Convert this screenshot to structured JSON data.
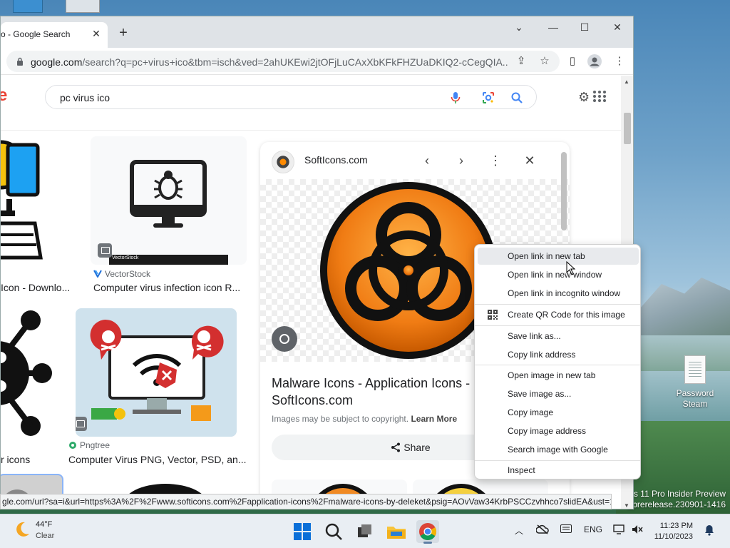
{
  "desktop": {
    "icon_label_line1": "Password",
    "icon_label_line2": "Steam",
    "watermark_line1": "ws 11 Pro Insider Preview",
    "watermark_line2": "s_prerelease.230901-1416"
  },
  "browser": {
    "tab_title": "o - Google Search",
    "new_tab": "+",
    "url_host": "google.com",
    "url_path": "/search?q=pc+virus+ico&tbm=isch&ved=2ahUKEwi2jtOFjLuCAxXbKFkFHZUaDKIQ2-cCegQIA...",
    "status_url": "gle.com/url?sa=i&url=https%3A%2F%2Fwww.softicons.com%2Fapplication-icons%2Fmalware-icons-by-deleket&psig=AOvVaw34KrbPSCCzvhhco7slidEA&ust=1..."
  },
  "google": {
    "logo_fragment": "e",
    "query": "pc virus ico"
  },
  "results": [
    {
      "source": "",
      "title": "Icon - Downlo..."
    },
    {
      "source": "VectorStock",
      "title": "Computer virus infection icon R..."
    },
    {
      "source": "",
      "title": "r icons"
    },
    {
      "source": "Pngtree",
      "title": "Computer Virus PNG, Vector, PSD, an..."
    }
  ],
  "vectorstock_banner": "VectorStock",
  "preview": {
    "site": "SoftIcons.com",
    "title": "Malware Icons - Application Icons - SoftIcons.com",
    "copyright": "Images may be subject to copyright.",
    "learn_more": "Learn More",
    "share": "Share"
  },
  "context_menu": [
    {
      "label": "Open link in new tab"
    },
    {
      "label": "Open link in new window"
    },
    {
      "label": "Open link in incognito window"
    },
    {
      "label": "Create QR Code for this image"
    },
    {
      "label": "Save link as..."
    },
    {
      "label": "Copy link address"
    },
    {
      "label": "Open image in new tab"
    },
    {
      "label": "Save image as..."
    },
    {
      "label": "Copy image"
    },
    {
      "label": "Copy image address"
    },
    {
      "label": "Search image with Google"
    },
    {
      "label": "Inspect"
    }
  ],
  "taskbar": {
    "temperature": "44°F",
    "condition": "Clear",
    "lang": "ENG",
    "time": "11:23 PM",
    "date": "11/10/2023"
  },
  "colors": {
    "accent_blue": "#1a73e8",
    "biohazard_orange": "#f07c14",
    "danger_red": "#d32f2f"
  }
}
